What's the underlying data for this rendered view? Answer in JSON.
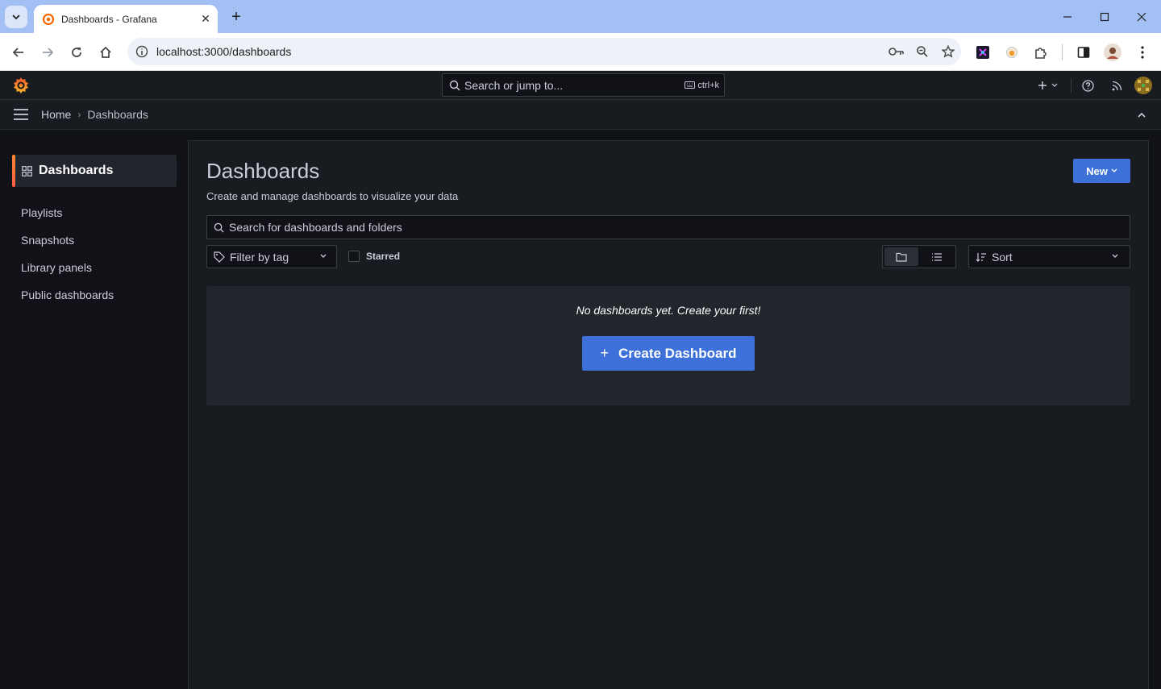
{
  "browser": {
    "tab_title": "Dashboards - Grafana",
    "url": "localhost:3000/dashboards"
  },
  "grafana": {
    "search_placeholder": "Search or jump to...",
    "search_shortcut": "ctrl+k",
    "breadcrumb": {
      "home": "Home",
      "separator": "›",
      "current": "Dashboards"
    },
    "sidebar": {
      "active_section": "Dashboards",
      "items": [
        {
          "label": "Playlists"
        },
        {
          "label": "Snapshots"
        },
        {
          "label": "Library panels"
        },
        {
          "label": "Public dashboards"
        }
      ]
    },
    "page": {
      "title": "Dashboards",
      "subtitle": "Create and manage dashboards to visualize your data",
      "new_button": "New",
      "search_placeholder": "Search for dashboards and folders",
      "tag_filter_placeholder": "Filter by tag",
      "starred_label": "Starred",
      "sort_placeholder": "Sort",
      "empty_message": "No dashboards yet. Create your first!",
      "create_button": "Create Dashboard"
    }
  },
  "colors": {
    "accent_blue": "#3d71d9",
    "brand_orange": "#f55f3e",
    "background": "#111217",
    "panel": "#181b1f"
  }
}
